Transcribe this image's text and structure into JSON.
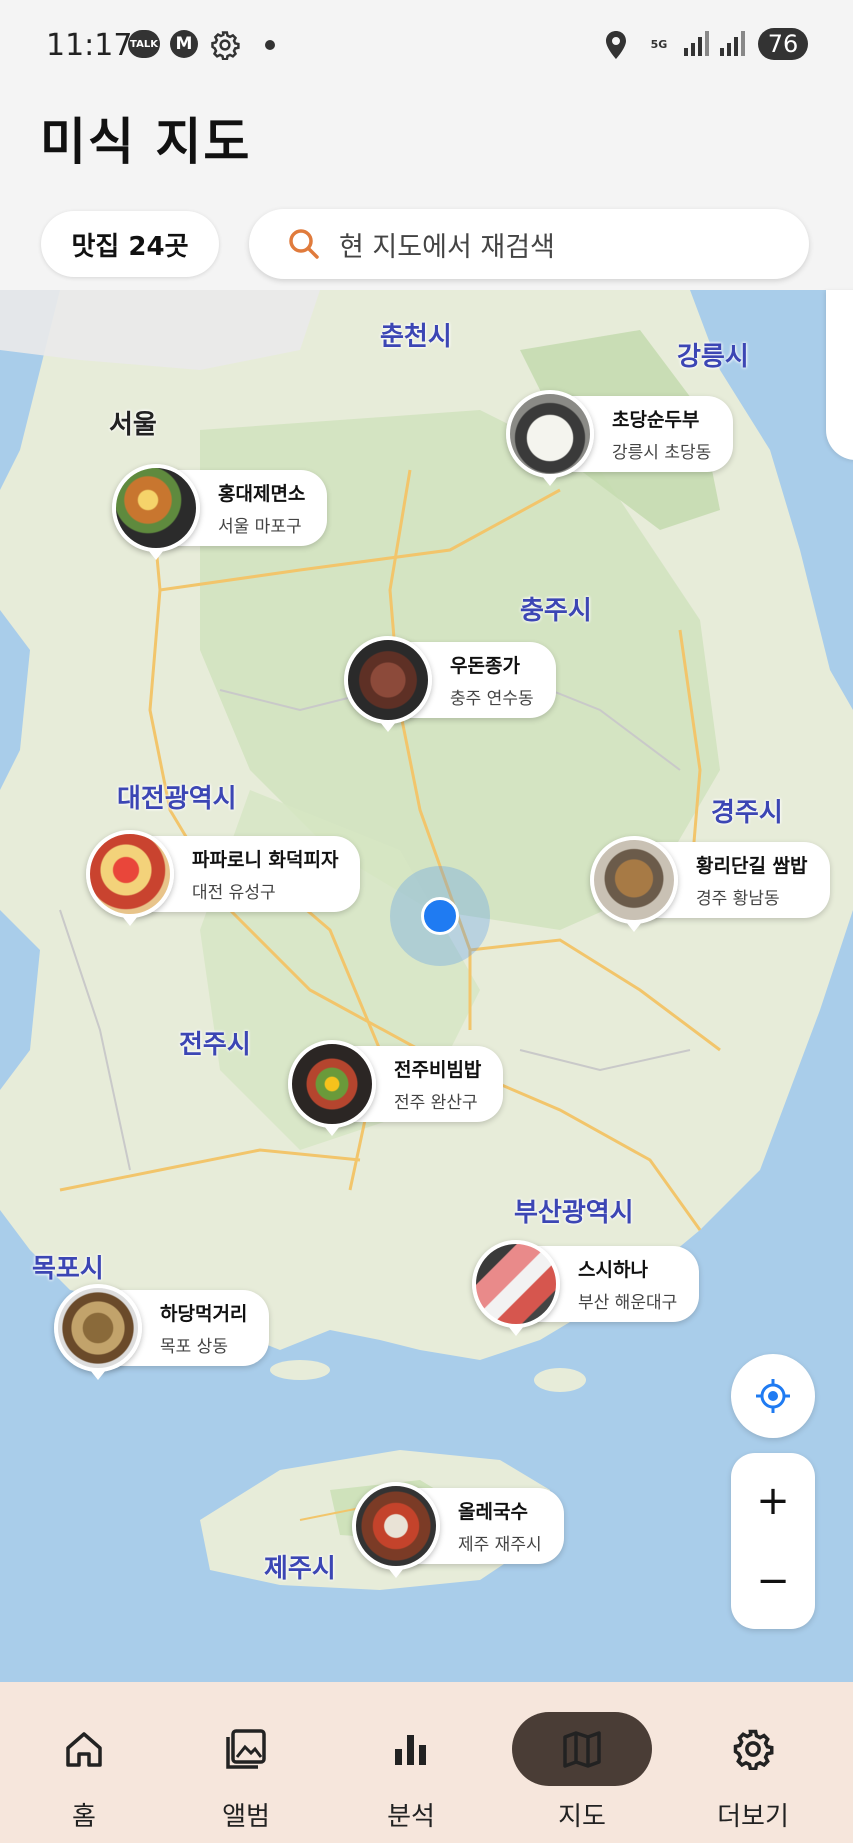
{
  "status_bar": {
    "time": "11:17",
    "talk_badge": "TALK",
    "m_badge": "M",
    "network": "5G",
    "battery": "76"
  },
  "header": {
    "title": "미식 지도",
    "count_chip": "맛집 24곳",
    "search_text": "현 지도에서 재검색"
  },
  "map": {
    "cities": [
      {
        "label": "춘천시"
      },
      {
        "label": "강릉시"
      },
      {
        "label": "서울"
      },
      {
        "label": "충주시"
      },
      {
        "label": "대전광역시"
      },
      {
        "label": "경주시"
      },
      {
        "label": "전주시"
      },
      {
        "label": "부산광역시"
      },
      {
        "label": "목포시"
      },
      {
        "label": "제주시"
      }
    ],
    "restaurants": [
      {
        "name": "초당순두부",
        "area": "강릉시 초당동"
      },
      {
        "name": "홍대제면소",
        "area": "서울 마포구"
      },
      {
        "name": "우돈종가",
        "area": "충주 연수동"
      },
      {
        "name": "파파로니 화덕피자",
        "area": "대전 유성구"
      },
      {
        "name": "황리단길 쌈밥",
        "area": "경주 황남동"
      },
      {
        "name": "전주비빔밥",
        "area": "전주 완산구"
      },
      {
        "name": "스시하나",
        "area": "부산 해운대구"
      },
      {
        "name": "하당먹거리",
        "area": "목포 상동"
      },
      {
        "name": "올레국수",
        "area": "제주 재주시"
      }
    ],
    "zoom_in": "+",
    "zoom_out": "−",
    "locate_icon": "crosshair-icon"
  },
  "bottom_nav": [
    {
      "label": "홈",
      "icon": "home-icon"
    },
    {
      "label": "앨범",
      "icon": "album-icon"
    },
    {
      "label": "분석",
      "icon": "chart-icon"
    },
    {
      "label": "지도",
      "icon": "map-icon",
      "active": true
    },
    {
      "label": "더보기",
      "icon": "gear-icon"
    }
  ],
  "colors": {
    "accent_nav": "#4a3d36",
    "nav_bg": "#f6e6dc",
    "city_label": "#3c46b4",
    "location_dot": "#1f7bf2",
    "search_icon": "#e07b3c"
  }
}
